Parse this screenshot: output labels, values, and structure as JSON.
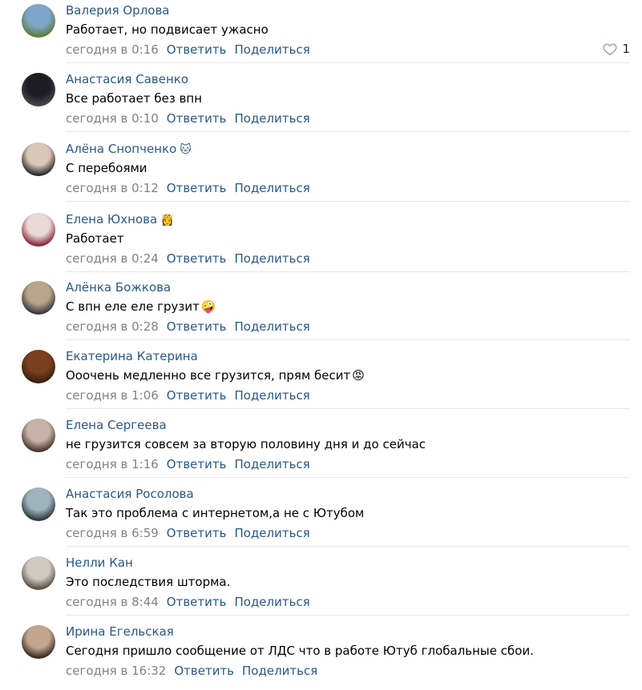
{
  "comments": [
    {
      "author": "Валерия Орлова",
      "author_emoji": "",
      "text": "Работает, но подвисает ужасно",
      "text_emoji": "",
      "time": "сегодня в 0:16",
      "reply": "Ответить",
      "share": "Поделиться",
      "likes": "1",
      "avatar_colors": [
        "#7fa6c9",
        "#5b7d3c"
      ]
    },
    {
      "author": "Анастасия Савенко",
      "author_emoji": "",
      "text": "Все работает без впн",
      "text_emoji": "",
      "time": "сегодня в 0:10",
      "reply": "Ответить",
      "share": "Поделиться",
      "likes": "",
      "avatar_colors": [
        "#1c1c22",
        "#44444c"
      ]
    },
    {
      "author": "Алёна Снопченко",
      "author_emoji": "🐱",
      "text": "С перебоями",
      "text_emoji": "",
      "time": "сегодня в 0:12",
      "reply": "Ответить",
      "share": "Поделиться",
      "likes": "",
      "avatar_colors": [
        "#d9c7b8",
        "#2b2b2b"
      ]
    },
    {
      "author": "Елена Юхнова",
      "author_emoji": "👸",
      "text": "Работает",
      "text_emoji": "",
      "time": "сегодня в 0:24",
      "reply": "Ответить",
      "share": "Поделиться",
      "likes": "",
      "avatar_colors": [
        "#e9d9d6",
        "#8a2a3a"
      ]
    },
    {
      "author": "Алёнка Божкова",
      "author_emoji": "",
      "text": "С впн еле еле грузит",
      "text_emoji": "🤪",
      "time": "сегодня в 0:28",
      "reply": "Ответить",
      "share": "Поделиться",
      "likes": "",
      "avatar_colors": [
        "#b9a58a",
        "#3a3a3a"
      ]
    },
    {
      "author": "Екатерина Катерина",
      "author_emoji": "",
      "text": "Ооочень медленно все грузится, прям бесит",
      "text_emoji": "😡",
      "time": "сегодня в 1:06",
      "reply": "Ответить",
      "share": "Поделиться",
      "likes": "",
      "avatar_colors": [
        "#7a3f1e",
        "#3a1f10"
      ]
    },
    {
      "author": "Елена Сергеева",
      "author_emoji": "",
      "text": "не грузится совсем за вторую половину дня и до сейчас",
      "text_emoji": "",
      "time": "сегодня в 1:16",
      "reply": "Ответить",
      "share": "Поделиться",
      "likes": "",
      "avatar_colors": [
        "#c7b2a9",
        "#4a3630"
      ]
    },
    {
      "author": "Анастасия Росолова",
      "author_emoji": "",
      "text": "Так это проблема с интернетом,а не с Ютубом",
      "text_emoji": "",
      "time": "сегодня в 6:59",
      "reply": "Ответить",
      "share": "Поделиться",
      "likes": "",
      "avatar_colors": [
        "#9fb3bd",
        "#2d3a40"
      ]
    },
    {
      "author": "Нелли Кан",
      "author_emoji": "",
      "text": "Это последствия шторма.",
      "text_emoji": "",
      "time": "сегодня в 8:44",
      "reply": "Ответить",
      "share": "Поделиться",
      "likes": "",
      "avatar_colors": [
        "#cfcac2",
        "#5a5246"
      ]
    },
    {
      "author": "Ирина Егельская",
      "author_emoji": "",
      "text": "Сегодня пришло сообщение от ЛДС что в работе Ютуб глобальные сбои.",
      "text_emoji": "",
      "time": "сегодня в 16:32",
      "reply": "Ответить",
      "share": "Поделиться",
      "likes": "",
      "avatar_colors": [
        "#c2a68e",
        "#3b2a22"
      ]
    }
  ]
}
